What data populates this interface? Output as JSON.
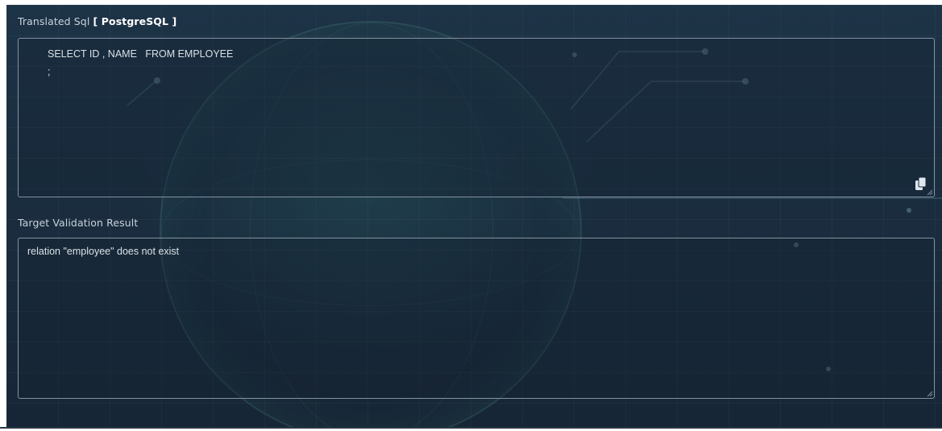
{
  "translated_sql": {
    "label_prefix": "Translated Sql ",
    "label_db": "[ PostgreSQL ]",
    "code": "SELECT ID , NAME   FROM EMPLOYEE\n;",
    "copy_icon": "copy-icon"
  },
  "validation": {
    "label": "Target Validation Result",
    "message": "relation \"employee\" does not exist"
  },
  "colors": {
    "panel_bg": "#1a2d3f",
    "text": "#d9e0e6",
    "border": "#8392a0"
  }
}
